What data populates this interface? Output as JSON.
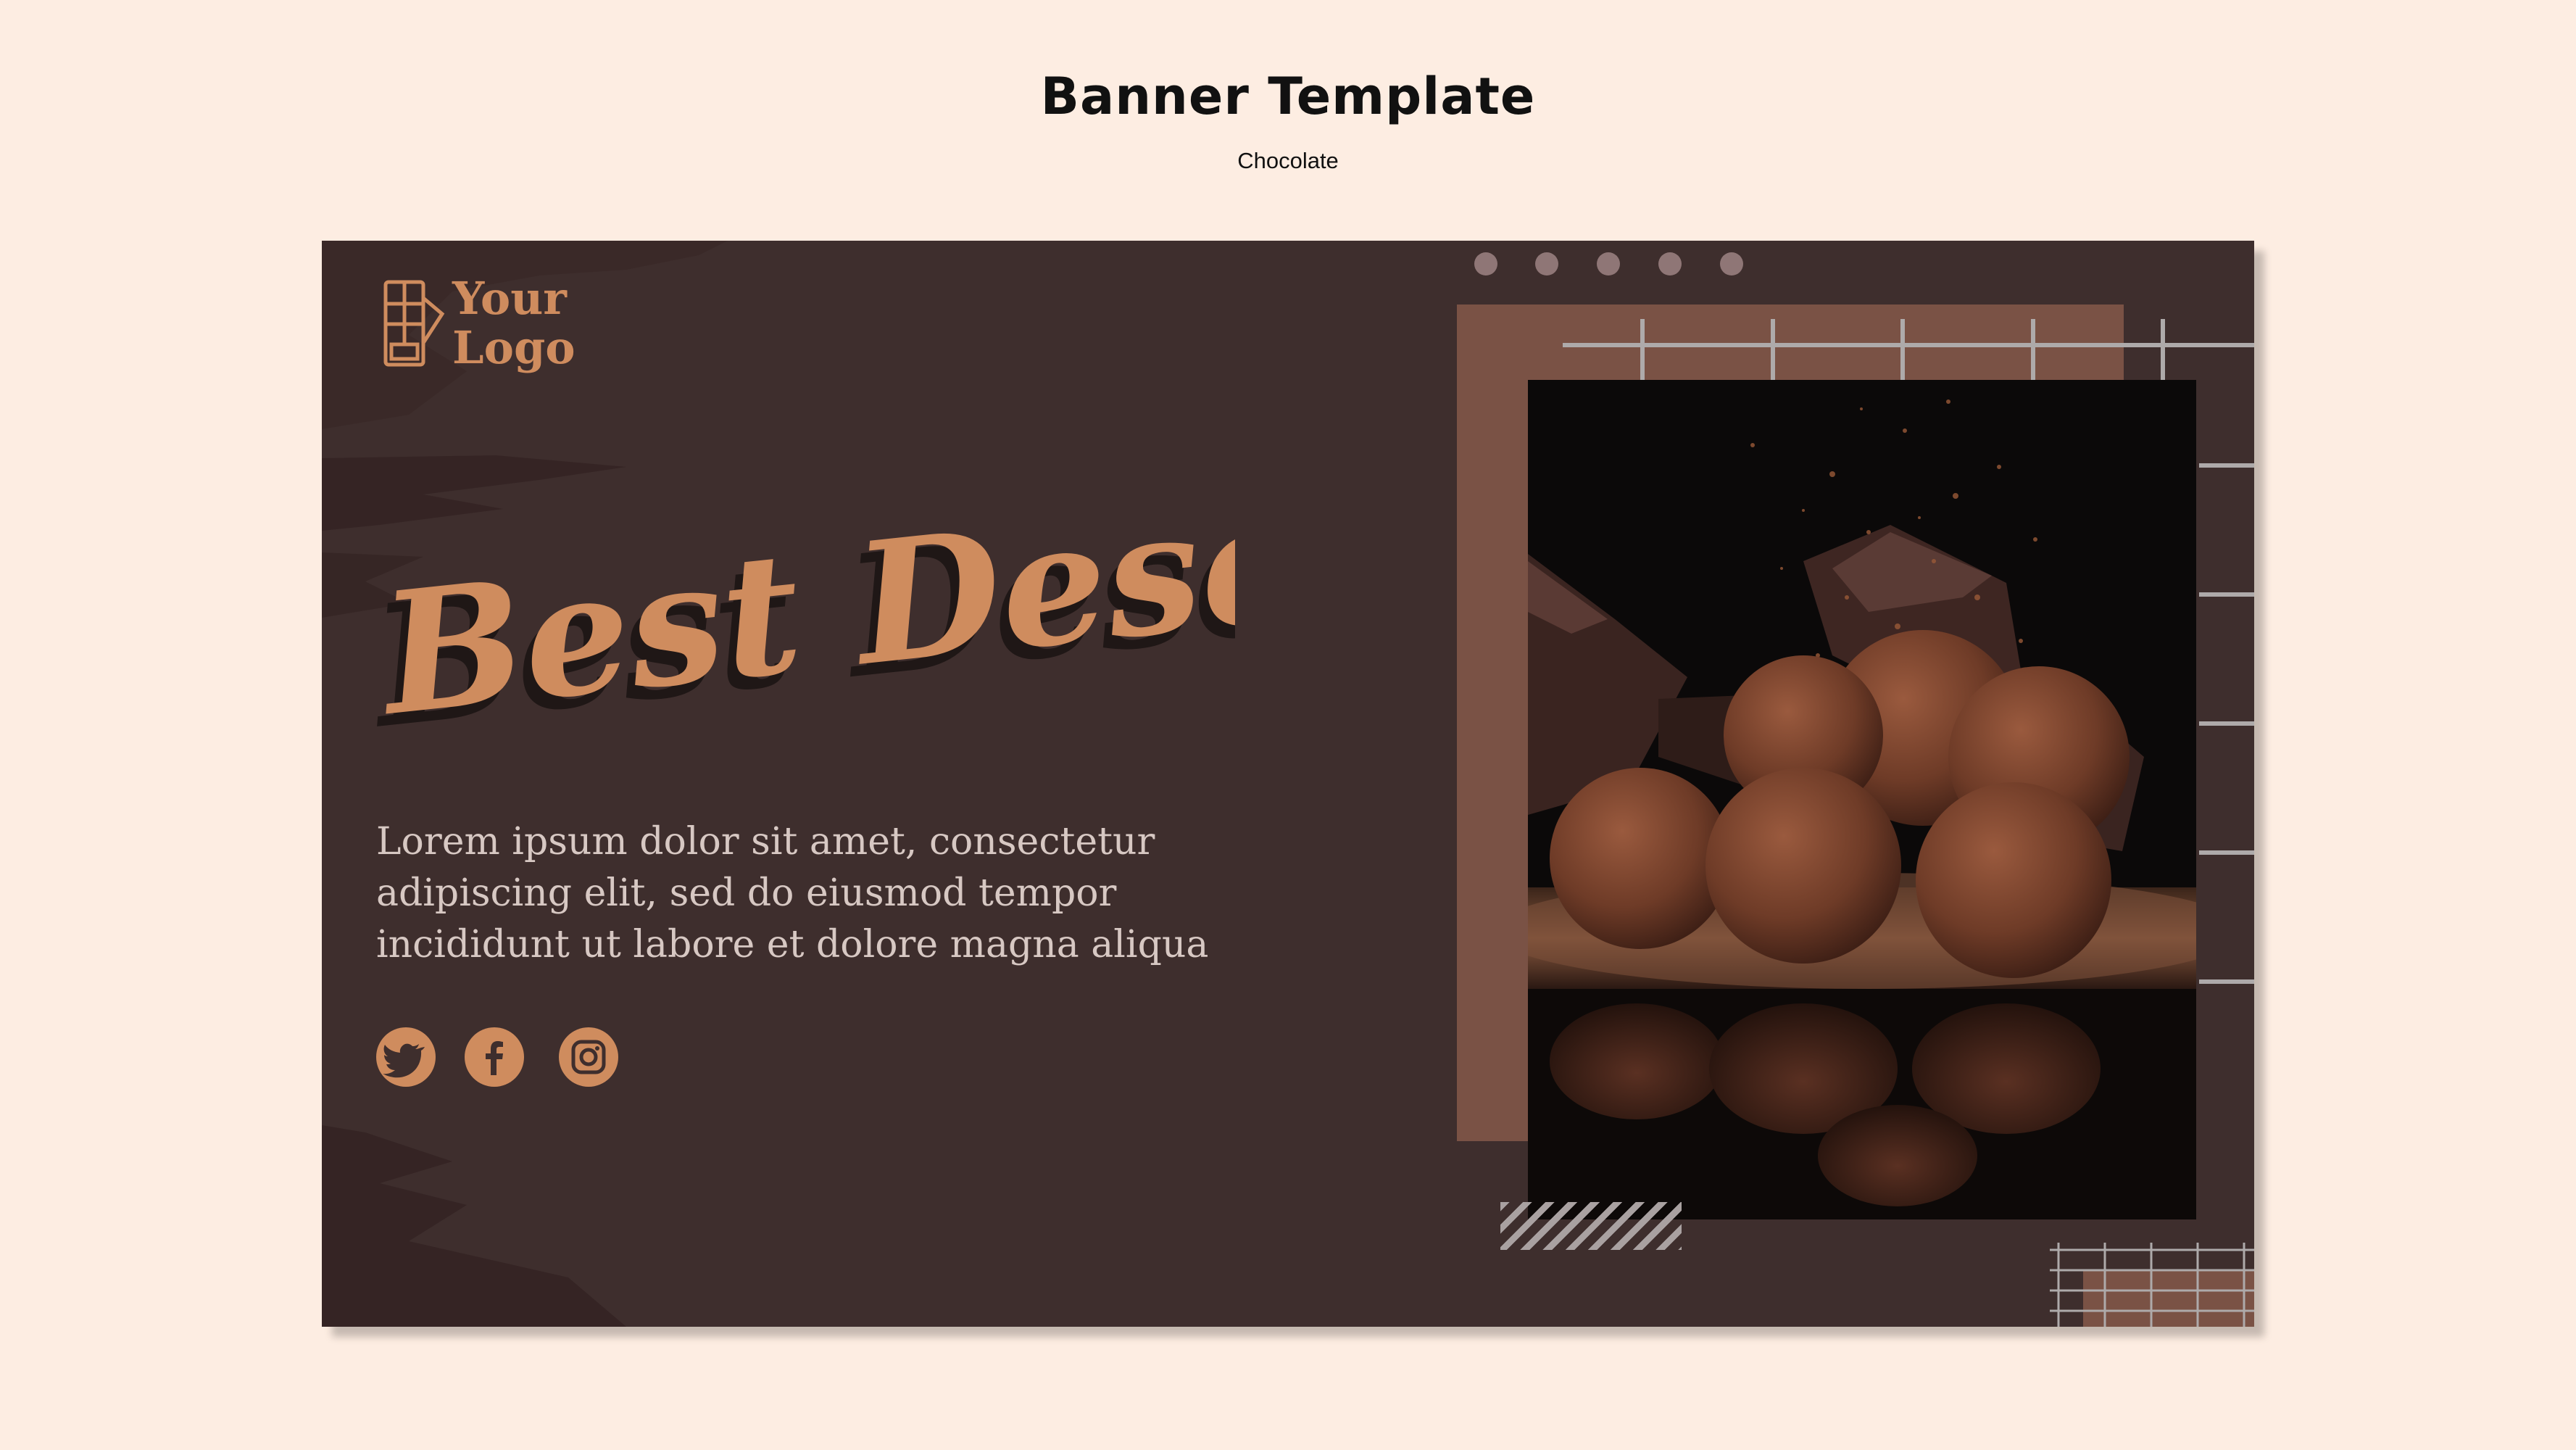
{
  "header": {
    "title": "Banner Template",
    "subtitle": "Chocolate"
  },
  "banner": {
    "logo": {
      "line1": "Your",
      "line2": "Logo",
      "icon": "chocolate-bar-icon"
    },
    "headline": "Best Desert",
    "body": "Lorem ipsum dolor sit amet, consectetur adipiscing elit, sed do eiusmod tempor incididunt ut labore et dolore magna aliqua",
    "social": [
      {
        "name": "twitter",
        "icon": "twitter-icon"
      },
      {
        "name": "facebook",
        "icon": "facebook-icon"
      },
      {
        "name": "instagram",
        "icon": "instagram-icon"
      }
    ],
    "photo": {
      "subject": "chocolate truffles"
    }
  },
  "colors": {
    "page_background": "#fdede2",
    "banner_background": "#3e2e2d",
    "accent": "#cf8c5e",
    "frame": "#7a5245",
    "text_light": "#d7c8c3",
    "dots": "#8f7676",
    "grid_lines": "#aeaaaa"
  }
}
